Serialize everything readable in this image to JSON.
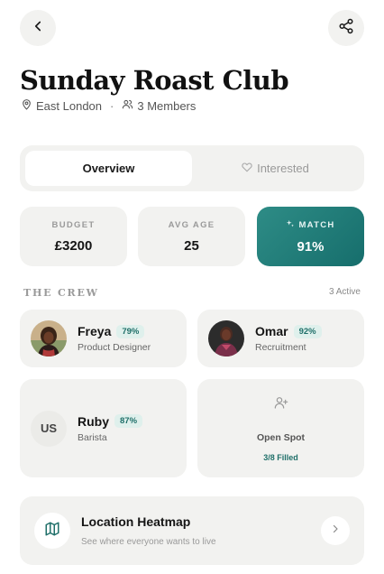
{
  "header": {
    "back_icon": "chevron-left-icon",
    "share_icon": "share-icon"
  },
  "club": {
    "title": "Sunday Roast Club",
    "location": "East London",
    "separator": "·",
    "members": "3 Members"
  },
  "tabs": [
    {
      "label": "Overview",
      "active": true
    },
    {
      "label": "Interested",
      "active": false,
      "icon": "heart-icon"
    }
  ],
  "stats": [
    {
      "label": "BUDGET",
      "value": "£3200"
    },
    {
      "label": "AVG AGE",
      "value": "25"
    },
    {
      "label": "MATCH",
      "value": "91%",
      "icon": "sparkle-icon"
    }
  ],
  "crew": {
    "title": "THE CREW",
    "count": "3 Active",
    "members": [
      {
        "name": "Freya",
        "match": "79%",
        "role": "Product Designer"
      },
      {
        "name": "Omar",
        "match": "92%",
        "role": "Recruitment"
      },
      {
        "name": "Ruby",
        "match": "87%",
        "role": "Barista",
        "initials": "US"
      }
    ],
    "open_spot": {
      "label": "Open Spot",
      "filled": "3/8 Filled",
      "icon": "add-user-icon"
    }
  },
  "heatmap": {
    "title": "Location Heatmap",
    "subtitle": "See where everyone wants to live",
    "icon": "map-icon"
  },
  "colors": {
    "accent": "#1f6f69",
    "match_card": "#237c78",
    "card_bg": "#f2f2f0"
  }
}
